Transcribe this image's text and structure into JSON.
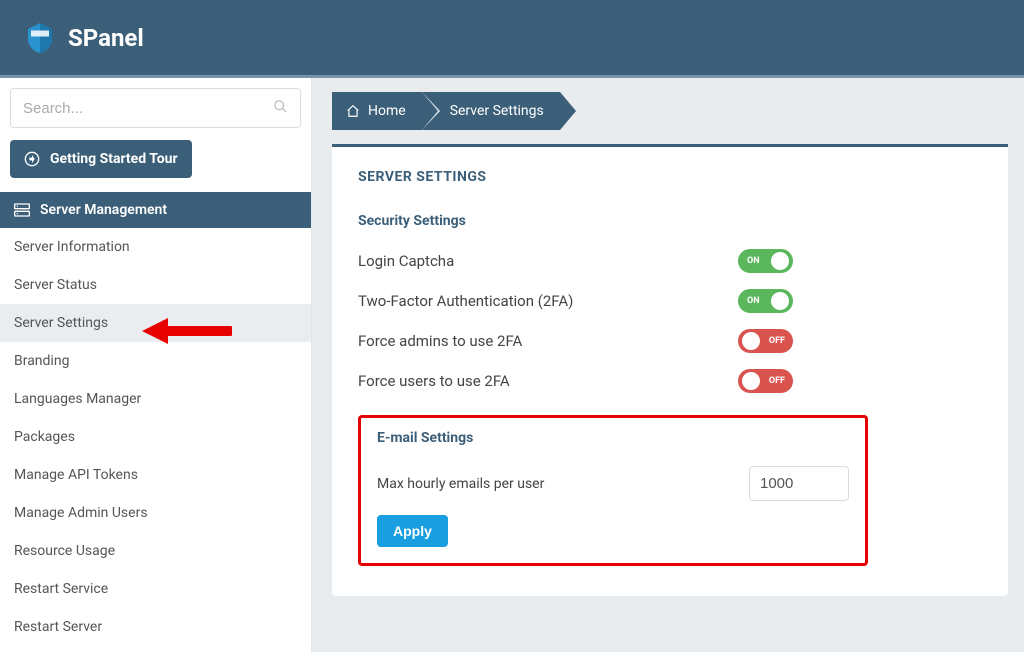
{
  "header": {
    "app_name": "SPanel"
  },
  "sidebar": {
    "search_placeholder": "Search...",
    "tour_label": "Getting Started Tour",
    "section_header": "Server Management",
    "items": [
      {
        "label": "Server Information",
        "active": false
      },
      {
        "label": "Server Status",
        "active": false
      },
      {
        "label": "Server Settings",
        "active": true
      },
      {
        "label": "Branding",
        "active": false
      },
      {
        "label": "Languages Manager",
        "active": false
      },
      {
        "label": "Packages",
        "active": false
      },
      {
        "label": "Manage API Tokens",
        "active": false
      },
      {
        "label": "Manage Admin Users",
        "active": false
      },
      {
        "label": "Resource Usage",
        "active": false
      },
      {
        "label": "Restart Service",
        "active": false
      },
      {
        "label": "Restart Server",
        "active": false
      }
    ]
  },
  "breadcrumb": {
    "home": "Home",
    "current": "Server Settings"
  },
  "panel": {
    "title": "SERVER SETTINGS",
    "security": {
      "title": "Security Settings",
      "rows": [
        {
          "label": "Login Captcha",
          "state": "on",
          "text": "ON"
        },
        {
          "label": "Two-Factor Authentication (2FA)",
          "state": "on",
          "text": "ON"
        },
        {
          "label": "Force admins to use 2FA",
          "state": "off",
          "text": "OFF"
        },
        {
          "label": "Force users to use 2FA",
          "state": "off",
          "text": "OFF"
        }
      ]
    },
    "email": {
      "title": "E-mail Settings",
      "max_hourly_label": "Max hourly emails per user",
      "max_hourly_value": "1000",
      "apply_label": "Apply"
    }
  }
}
